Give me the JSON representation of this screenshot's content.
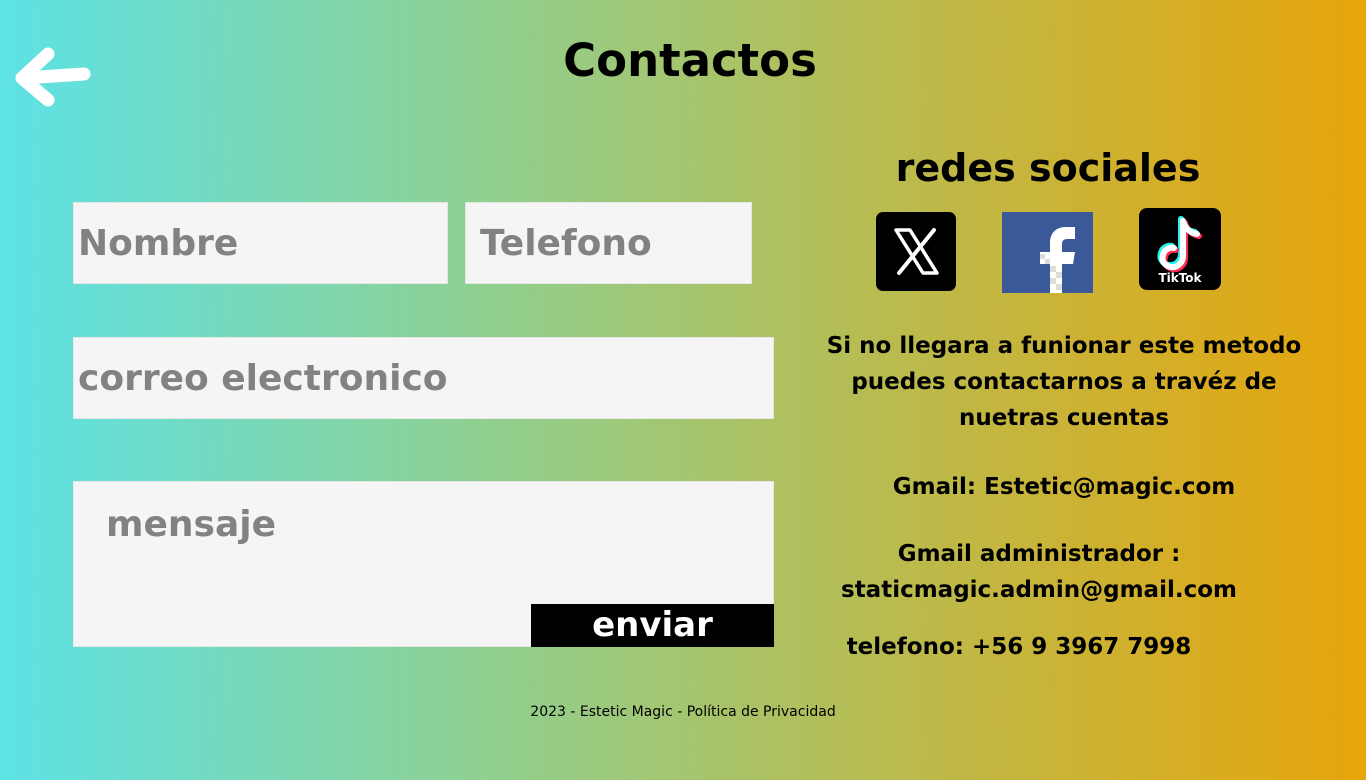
{
  "page_title": "Contactos",
  "form": {
    "nombre_placeholder": "Nombre",
    "telefono_placeholder": "Telefono",
    "correo_placeholder": "correo electronico",
    "mensaje_placeholder": "mensaje",
    "send_label": "enviar"
  },
  "social": {
    "title": "redes sociales",
    "items": [
      {
        "icon": "x-logo-icon"
      },
      {
        "icon": "facebook-logo-icon"
      },
      {
        "icon": "tiktok-logo-icon",
        "label": "TikTok"
      }
    ]
  },
  "info": {
    "notice": "Si no llegara a funionar este metodo puedes contactarnos a travéz de nuetras cuentas",
    "gmail": "Gmail: Estetic@magic.com",
    "admin_label": "Gmail administrador :",
    "admin_email": "staticmagic.admin@gmail.com",
    "phone": "telefono: +56 9 3967 7998"
  },
  "footer": "2023 - Estetic Magic - Política de Privacidad",
  "colors": {
    "gradient_left": "#5de2e6",
    "gradient_right": "#e7a50a",
    "field_bg": "#f5f5f5",
    "placeholder": "#828282"
  }
}
